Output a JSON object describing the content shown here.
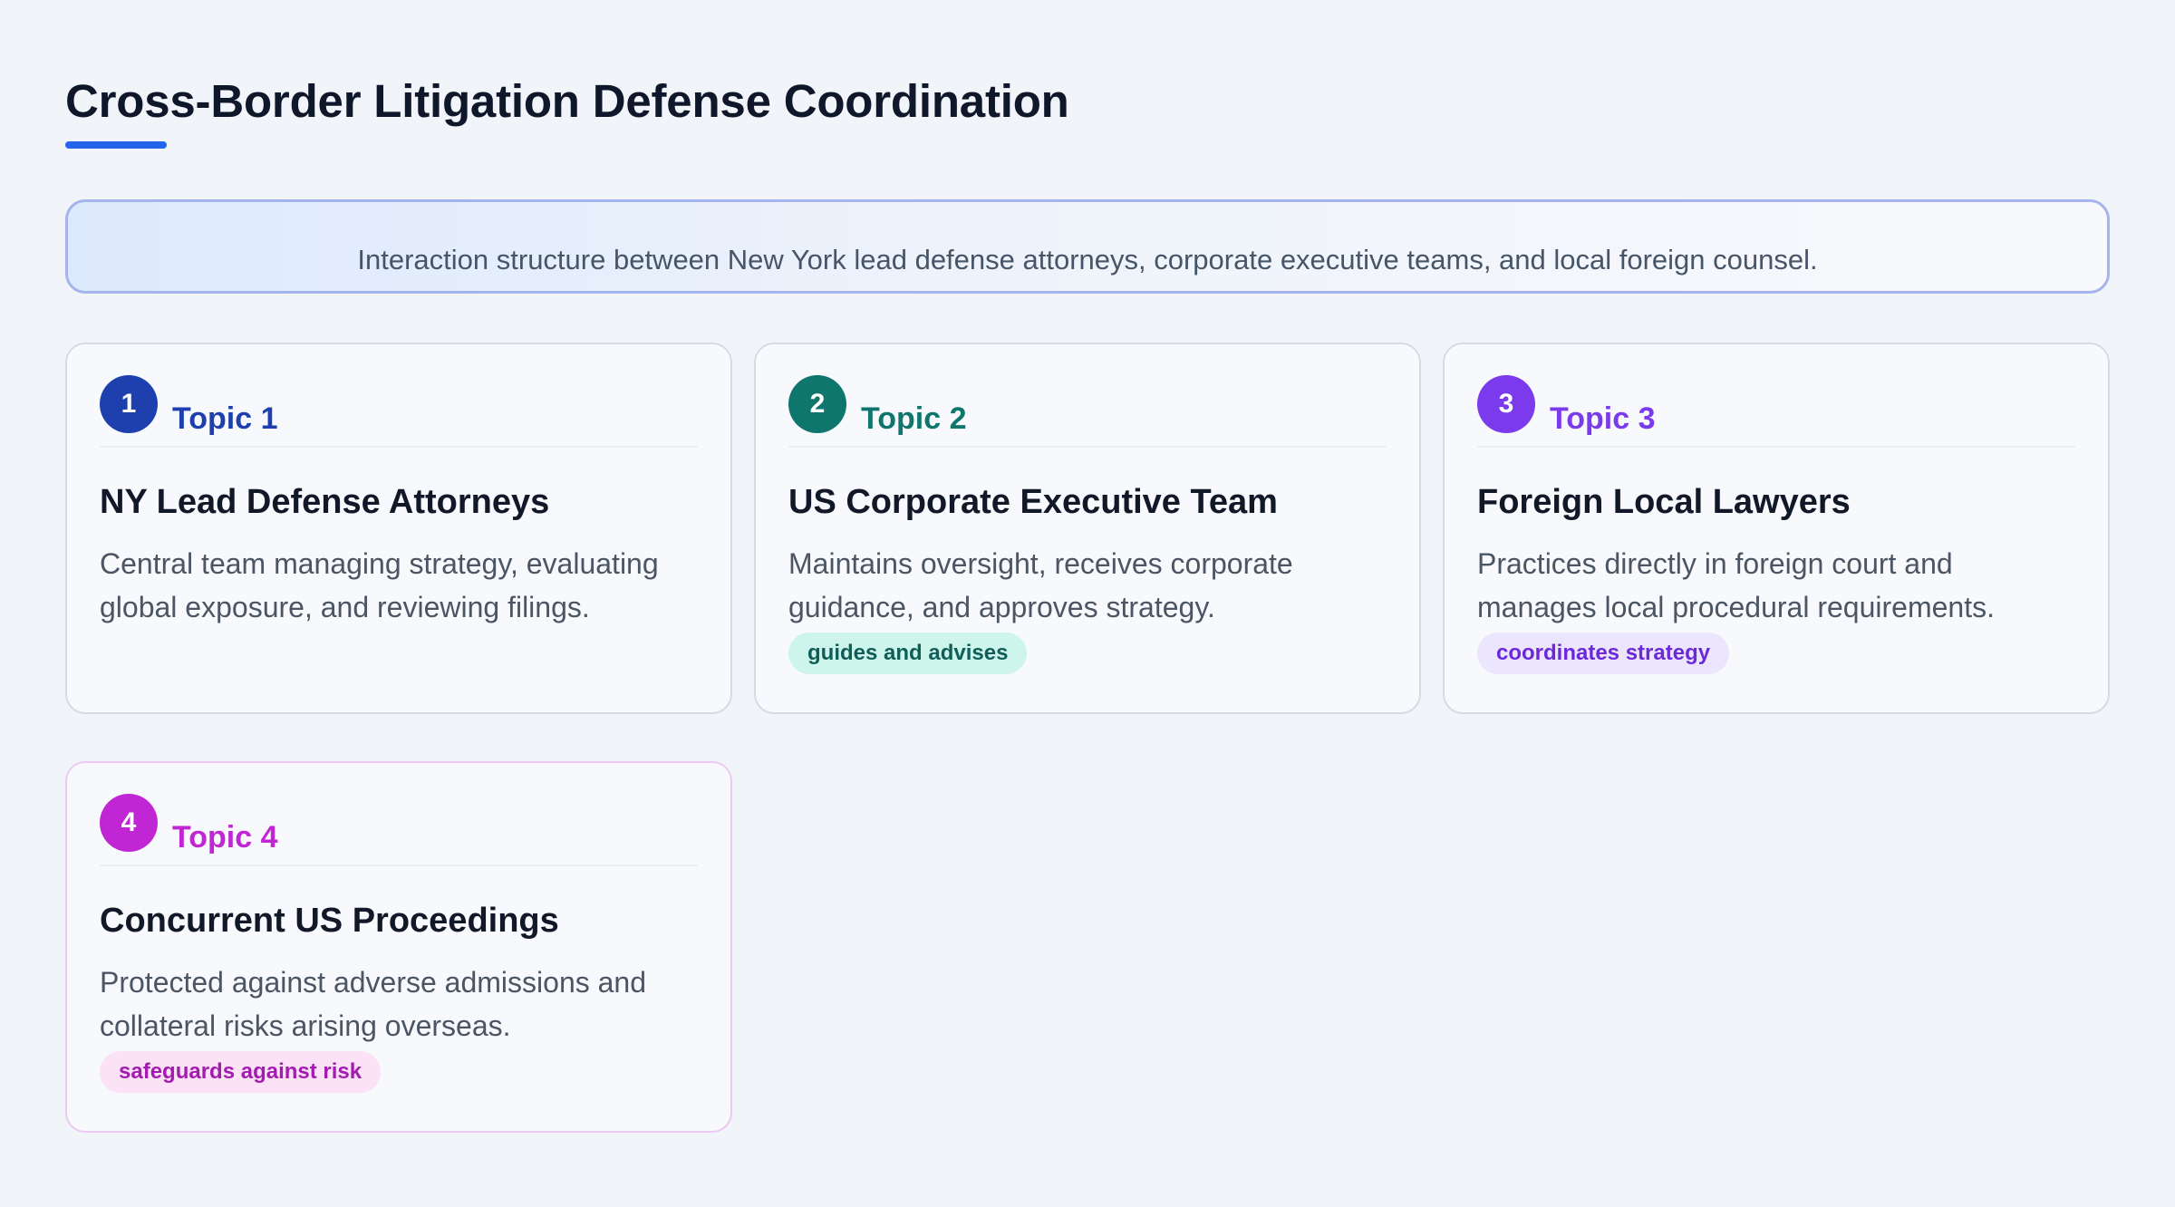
{
  "title": "Cross-Border Litigation Defense Coordination",
  "intro": "Interaction structure between New York lead defense attorneys, corporate executive teams, and local foreign counsel.",
  "colors": {
    "accent": "#2563eb",
    "topic1": "#1e40af",
    "topic2": "#0f766e",
    "topic3": "#7c3aed",
    "topic4": "#c026d3"
  },
  "topics": [
    {
      "number": "1",
      "label": "Topic 1",
      "title": "NY Lead Defense Attorneys",
      "description": "Central team managing strategy, evaluating global exposure, and reviewing filings.",
      "tag": ""
    },
    {
      "number": "2",
      "label": "Topic 2",
      "title": "US Corporate Executive Team",
      "description": "Maintains oversight, receives corporate guidance, and approves strategy.",
      "tag": "guides and advises"
    },
    {
      "number": "3",
      "label": "Topic 3",
      "title": "Foreign Local Lawyers",
      "description": "Practices directly in foreign court and manages local procedural requirements.",
      "tag": "coordinates strategy"
    },
    {
      "number": "4",
      "label": "Topic 4",
      "title": "Concurrent US Proceedings",
      "description": "Protected against adverse admissions and collateral risks arising overseas.",
      "tag": "safeguards against risk"
    }
  ]
}
